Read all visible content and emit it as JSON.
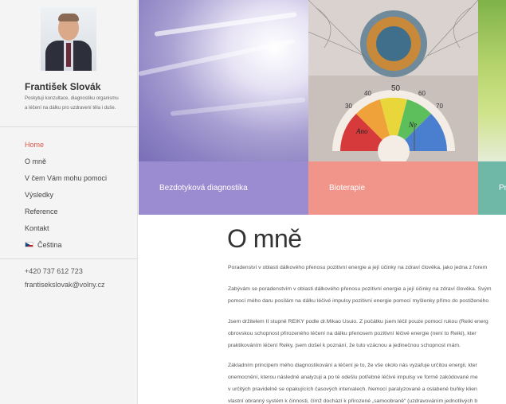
{
  "profile": {
    "name": "František Slovák",
    "tagline": "Poskytuji konzultace, diagnostiku organismu a léčení na dálku pro uzdravení těla i duše."
  },
  "nav": {
    "items": [
      {
        "label": "Home",
        "active": true
      },
      {
        "label": "O mně",
        "active": false
      },
      {
        "label": "V čem Vám mohu pomoci",
        "active": false
      },
      {
        "label": "Výsledky",
        "active": false
      },
      {
        "label": "Reference",
        "active": false
      },
      {
        "label": "Kontakt",
        "active": false
      },
      {
        "label": "Čeština",
        "active": false,
        "icon": "czech-flag-icon"
      }
    ]
  },
  "contact": {
    "phone": "+420 737 612 723",
    "email": "frantisekslovak@volny.cz"
  },
  "banner": {
    "tiles": [
      {
        "caption": "Bezdotyková diagnostika",
        "color": "#9b8bd0"
      },
      {
        "caption": "Bioterapie",
        "color": "#f1958a"
      },
      {
        "caption": "Pr",
        "color": "#6fb8a8"
      }
    ],
    "chart_numbers": [
      "50",
      "40",
      "60",
      "30",
      "70"
    ],
    "chart_words": [
      "Ano",
      "Ne"
    ]
  },
  "main": {
    "title": "O mně",
    "paragraphs": [
      [
        "Poradenství v oblasti dálkového přenosu pozitivní energie a její účinky na zdraví člověka, jako jedna z forem"
      ],
      [
        "Zabývám se poradenstvím v oblasti dálkového přenosu pozitivní energie a její účinky na zdraví člověka. Svým",
        "pomocí mého daru posílám na dálku léčivé impulsy pozitivní energie pomocí myšlenky přímo do postiženého"
      ],
      [
        "Jsem držitelem II stupně REIKY podle dr.Mikao Usuio. Z počátku jsem léčil pouze pomocí rukou (Reiki energ",
        "obrovskou schopnost přirozeného léčení na dálku přenosem pozitivní léčivé energie (není to Reiki), kter",
        "praktikováním léčení Reiky, jsem došel k poznání, že tuto vzácnou a jedinečnou schopnost mám."
      ],
      [
        "Základním principem mého diagnostikování a léčení je to, že vše okolo nás vyzařuje určitou energii, kter",
        "onemocnění, kterou následně analyzuji a po té odešlu potřebné léčivé impulsy ve formě zakódované me",
        "v určitých pravidelně se opakujících časových intervalech. Nemocí paralyzované a oslabené buňky klien",
        "vlastní obranný systém k činnosti, čímž dochází k přirozené „samoobraně“ (uzdravováním jednotlivých b"
      ]
    ]
  }
}
